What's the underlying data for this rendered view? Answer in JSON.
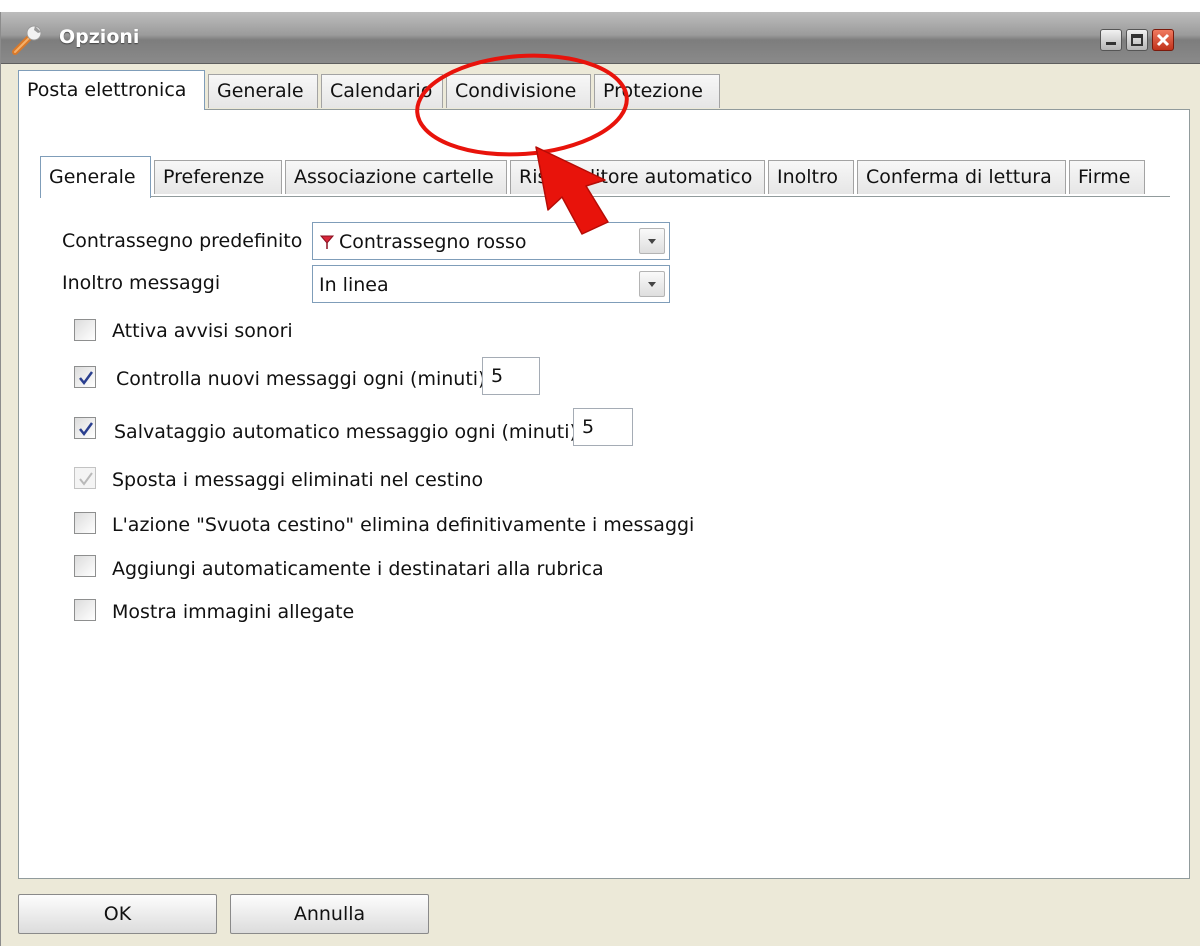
{
  "window": {
    "title": "Opzioni",
    "app_icon": "wrench-icon",
    "controls": [
      "minimize-icon",
      "maximize-icon",
      "close-icon"
    ]
  },
  "outer_tabs": [
    {
      "label": "Posta elettronica",
      "active": true
    },
    {
      "label": "Generale",
      "active": false
    },
    {
      "label": "Calendario",
      "active": false
    },
    {
      "label": "Condivisione",
      "active": false
    },
    {
      "label": "Protezione",
      "active": false
    }
  ],
  "inner_tabs": [
    {
      "label": "Generale",
      "active": true
    },
    {
      "label": "Preferenze",
      "active": false
    },
    {
      "label": "Associazione cartelle",
      "active": false
    },
    {
      "label": "Risponditore automatico",
      "active": false
    },
    {
      "label": "Inoltro",
      "active": false
    },
    {
      "label": "Conferma di lettura",
      "active": false
    },
    {
      "label": "Firme",
      "active": false
    }
  ],
  "form": {
    "default_flag": {
      "label": "Contrassegno predefinito",
      "value": "Contrassegno rosso",
      "icon": "red-flag-icon"
    },
    "forward": {
      "label": "Inoltro messaggi",
      "value": "In linea"
    },
    "options": [
      {
        "label": "Attiva avvisi sonori",
        "checked": false,
        "disabled": false
      },
      {
        "label": "Controlla nuovi messaggi ogni (minuti)",
        "checked": true,
        "disabled": false,
        "input_value": "5"
      },
      {
        "label": "Salvataggio automatico messaggio ogni (minuti)",
        "checked": true,
        "disabled": false,
        "input_value": "5"
      },
      {
        "label": "Sposta i messaggi eliminati nel cestino",
        "checked": true,
        "disabled": true
      },
      {
        "label": "L'azione \"Svuota cestino\" elimina definitivamente i messaggi",
        "checked": false,
        "disabled": false
      },
      {
        "label": "Aggiungi automaticamente i destinatari alla rubrica",
        "checked": false,
        "disabled": false
      },
      {
        "label": "Mostra immagini allegate",
        "checked": false,
        "disabled": false
      }
    ]
  },
  "buttons": {
    "ok": "OK",
    "cancel": "Annulla"
  },
  "annotation": {
    "color": "#e8130b",
    "highlighted_tab": "Condivisione"
  }
}
